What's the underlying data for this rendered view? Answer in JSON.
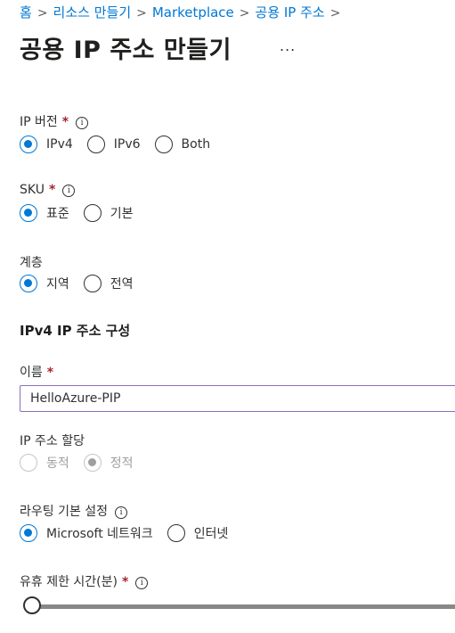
{
  "breadcrumb": {
    "items": [
      "홈",
      "리소스 만들기",
      "Marketplace",
      "공용 IP 주소"
    ],
    "separator": ">"
  },
  "page": {
    "title": "공용 IP 주소 만들기",
    "more": "..."
  },
  "ip_version": {
    "label": "IP 버전",
    "required": "*",
    "options": [
      "IPv4",
      "IPv6",
      "Both"
    ],
    "selected": "IPv4"
  },
  "sku": {
    "label": "SKU",
    "required": "*",
    "options": [
      "표준",
      "기본"
    ],
    "selected": "표준"
  },
  "tier": {
    "label": "계층",
    "options": [
      "지역",
      "전역"
    ],
    "selected": "지역"
  },
  "ipv4_section": {
    "title": "IPv4 IP 주소 구성"
  },
  "name": {
    "label": "이름",
    "required": "*",
    "value": "HelloAzure-PIP"
  },
  "assignment": {
    "label": "IP 주소 할당",
    "options": [
      "동적",
      "정적"
    ],
    "selected": "정적",
    "disabled": true
  },
  "routing": {
    "label": "라우팅 기본 설정",
    "options": [
      "Microsoft 네트워크",
      "인터넷"
    ],
    "selected": "Microsoft 네트워크"
  },
  "idle_timeout": {
    "label": "유휴 제한 시간(분)",
    "required": "*",
    "slider_fraction": 0
  },
  "icons": {
    "info": "i",
    "colors": {
      "accent": "#0078d4",
      "required": "#a4262c",
      "input_border": "#8a6dbb"
    }
  }
}
